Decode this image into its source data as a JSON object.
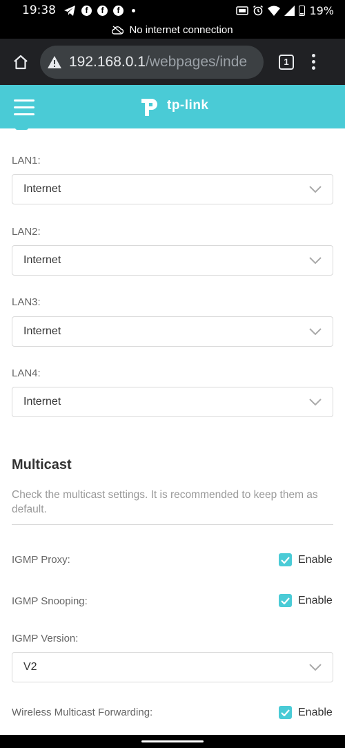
{
  "status_bar": {
    "time": "19:38",
    "battery": "19%"
  },
  "network_banner": {
    "text": "No internet connection"
  },
  "browser": {
    "url_host": "192.168.0.1",
    "url_path": "/webpages/inde",
    "tab_count": "1"
  },
  "header": {
    "logo_text": "tp-link"
  },
  "lan_ports": [
    {
      "label": "LAN1:",
      "value": "Internet"
    },
    {
      "label": "LAN2:",
      "value": "Internet"
    },
    {
      "label": "LAN3:",
      "value": "Internet"
    },
    {
      "label": "LAN4:",
      "value": "Internet"
    }
  ],
  "multicast": {
    "title": "Multicast",
    "description": "Check the multicast settings. It is recommended to keep them as default.",
    "igmp_proxy": {
      "label": "IGMP Proxy:",
      "checkbox_label": "Enable",
      "checked": true
    },
    "igmp_snooping": {
      "label": "IGMP Snooping:",
      "checkbox_label": "Enable",
      "checked": true
    },
    "igmp_version": {
      "label": "IGMP Version:",
      "value": "V2"
    },
    "wireless_forwarding": {
      "label": "Wireless Multicast Forwarding:",
      "checkbox_label": "Enable",
      "checked": true
    }
  },
  "colors": {
    "accent": "#4acbd6",
    "browser_toolbar": "#202124"
  }
}
